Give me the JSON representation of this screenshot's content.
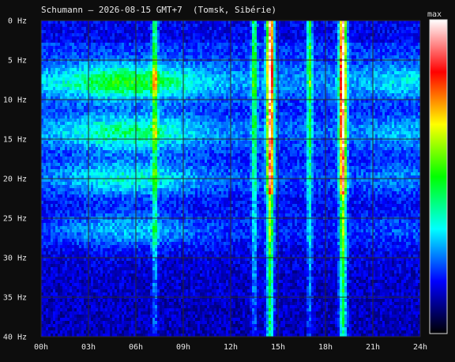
{
  "chart_data": {
    "type": "heatmap",
    "title": "Schumann — 2026-08-15 GMT+7  (Tomsk, Sibérie)",
    "y_ticks": [
      "0 Hz",
      "5 Hz",
      "10 Hz",
      "15 Hz",
      "20 Hz",
      "25 Hz",
      "30 Hz",
      "35 Hz",
      "40 Hz"
    ],
    "x_ticks": [
      "00h",
      "03h",
      "06h",
      "09h",
      "12h",
      "15h",
      "18h",
      "21h",
      "24h"
    ],
    "xlim": [
      0,
      24
    ],
    "ylim": [
      0,
      40
    ],
    "y_inverted": true,
    "grid": true,
    "colorbar": {
      "label": "max",
      "colors": [
        "#000000",
        "#0000ff",
        "#00ffff",
        "#00ff00",
        "#ffff00",
        "#ff0000",
        "#ffffff"
      ]
    },
    "resonance_bands_hz": [
      7.8,
      14.2,
      20.0,
      26.5
    ],
    "bursts_hours": [
      7.2,
      13.5,
      14.5,
      17.0,
      19.1
    ],
    "strong_bursts_hours": [
      14.5,
      19.1
    ]
  }
}
